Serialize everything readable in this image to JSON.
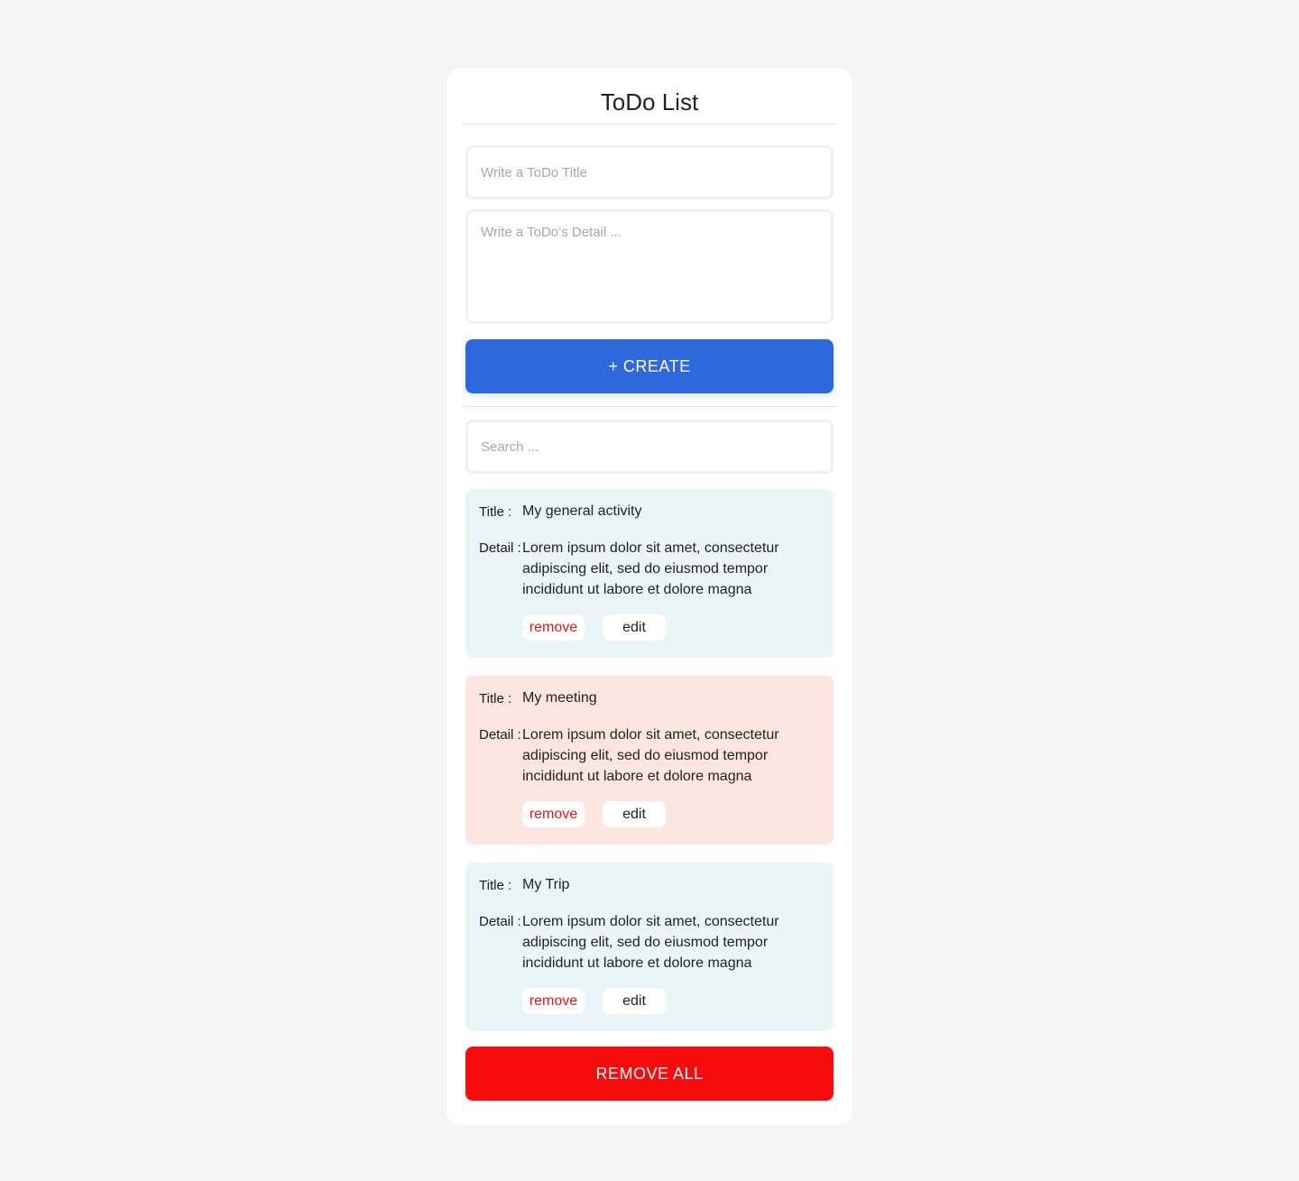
{
  "app": {
    "title": "ToDo List"
  },
  "form": {
    "title_placeholder": "Write a ToDo Title",
    "title_value": "",
    "detail_placeholder": "Write a ToDo’s Detail ...",
    "detail_value": "",
    "create_label": "+ CREATE"
  },
  "search": {
    "placeholder": "Search ...",
    "value": ""
  },
  "todos": [
    {
      "title_label": "Title :",
      "title": "My general activity",
      "detail_label": "Detail :",
      "detail": "Lorem ipsum dolor sit amet, consectetur adipiscing elit, sed do eiusmod tempor incididunt ut labore et dolore magna",
      "remove_label": "remove",
      "edit_label": "edit",
      "color": "#eaf5f7"
    },
    {
      "title_label": "Title :",
      "title": "My meeting",
      "detail_label": "Detail :",
      "detail": "Lorem ipsum dolor sit amet, consectetur adipiscing elit, sed do eiusmod tempor incididunt ut labore et dolore magna",
      "remove_label": "remove",
      "edit_label": "edit",
      "color": "#fde6df"
    },
    {
      "title_label": "Title :",
      "title": "My Trip",
      "detail_label": "Detail :",
      "detail": "Lorem ipsum dolor sit amet, consectetur adipiscing elit, sed do eiusmod tempor incididunt ut labore et dolore magna",
      "remove_label": "remove",
      "edit_label": "edit",
      "color": "#eaf5f7"
    }
  ],
  "footer": {
    "remove_all_label": "REMOVE ALL"
  },
  "colors": {
    "background": "#f6f5f6",
    "card": "#ffffff",
    "create_button": "#2d68dc",
    "remove_all_button": "#f60c0d",
    "remove_text": "#f0121b"
  }
}
